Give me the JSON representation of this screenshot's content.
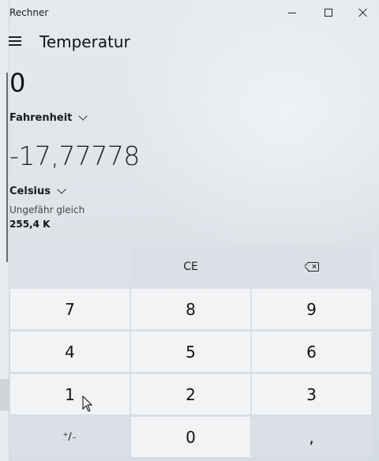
{
  "app": {
    "window_title": "Rechner",
    "mode_title": "Temperatur"
  },
  "converter": {
    "input_value": "0",
    "input_unit": "Fahrenheit",
    "output_value": "-17,77778",
    "output_unit": "Celsius",
    "approx_label": "Ungefähr gleich",
    "approx_value": "255,4 K"
  },
  "keypad": {
    "ce": "CE",
    "k7": "7",
    "k8": "8",
    "k9": "9",
    "k4": "4",
    "k5": "5",
    "k6": "6",
    "k1": "1",
    "k2": "2",
    "k3": "3",
    "sign": "⁺∕₋",
    "k0": "0",
    "decimal": ","
  },
  "icons": {
    "menu": "hamburger-icon",
    "backspace": "backspace-icon",
    "minimize": "minimize-icon",
    "maximize": "maximize-icon",
    "close": "close-icon"
  }
}
